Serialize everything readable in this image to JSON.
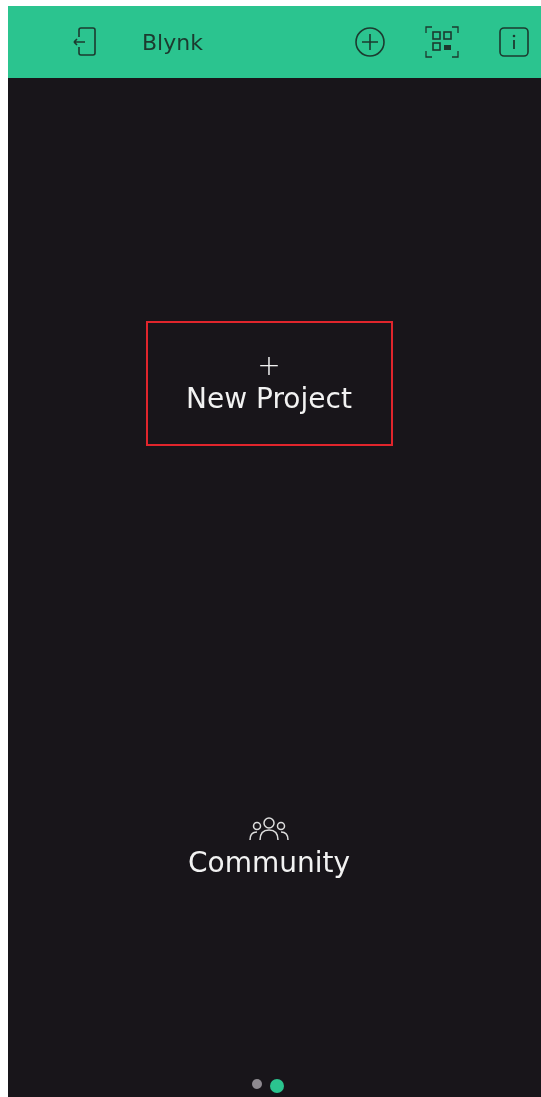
{
  "header": {
    "title": "Blynk"
  },
  "new_project": {
    "icon": "+",
    "label": "New Project"
  },
  "community": {
    "label": "Community"
  },
  "pages": [
    {
      "selected": false
    },
    {
      "selected": true
    }
  ]
}
